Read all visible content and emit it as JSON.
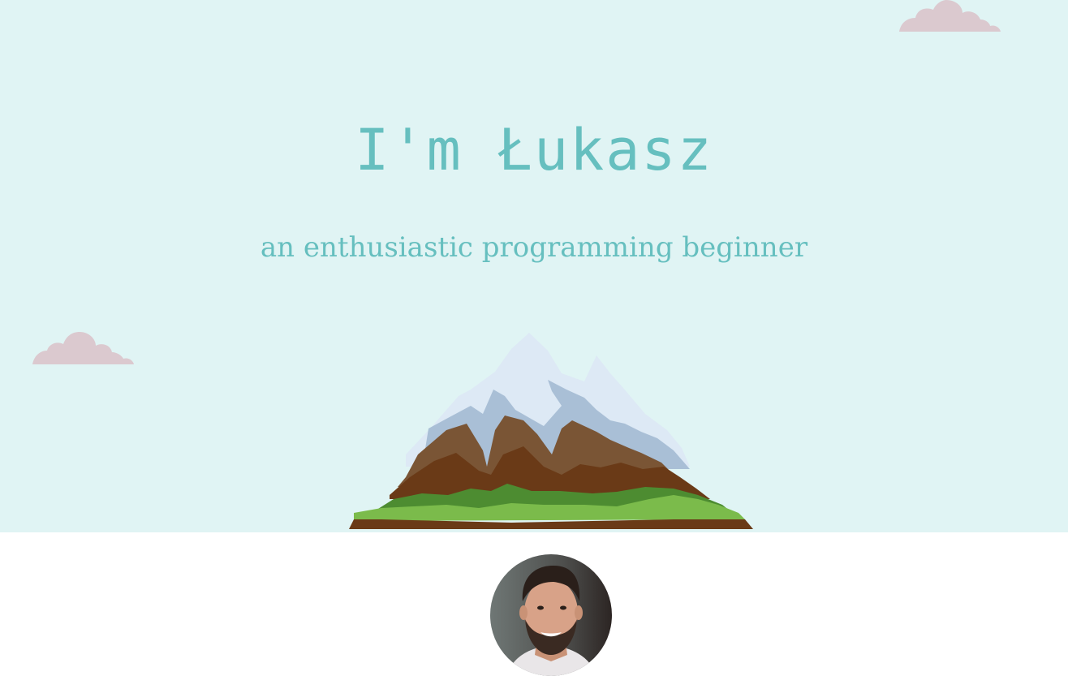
{
  "hero": {
    "title": "I'm Łukasz",
    "subtitle": "an enthusiastic programming beginner",
    "background_color": "#e0f4f4",
    "text_color": "#66bfbf"
  },
  "decorations": {
    "cloud_color": "#dbc9cf",
    "icons": [
      "cloud-icon",
      "cloud-icon",
      "mountain-illustration"
    ]
  },
  "profile": {
    "icon": "avatar-photo"
  }
}
